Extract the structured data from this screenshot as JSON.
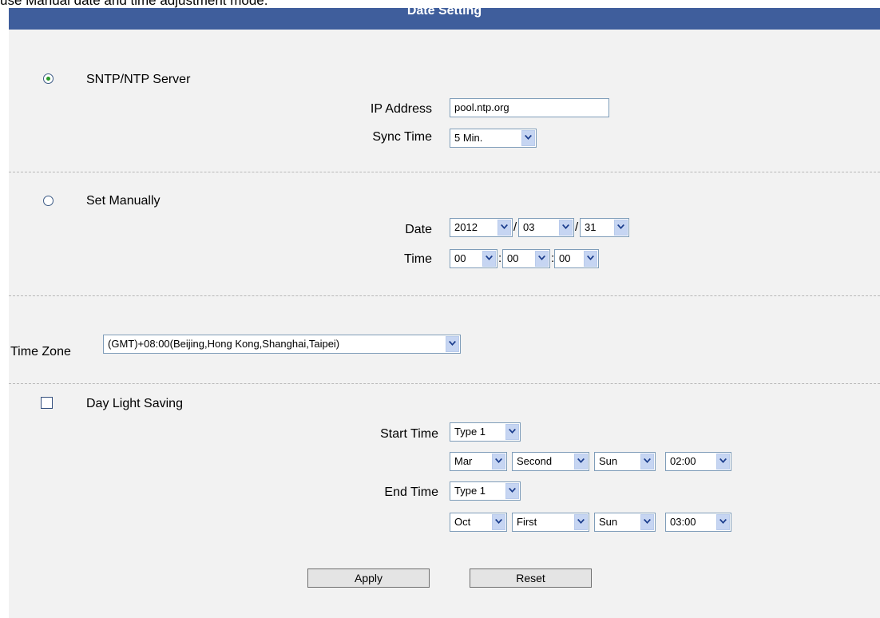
{
  "top_caption": "use Manual date and time adjustment mode.",
  "header": {
    "title": "Date Setting"
  },
  "sntp": {
    "label": "SNTP/NTP Server",
    "selected": true,
    "ip_label": "IP Address",
    "ip_value": "pool.ntp.org",
    "sync_label": "Sync Time",
    "sync_value": "5 Min."
  },
  "manual": {
    "label": "Set Manually",
    "selected": false,
    "date_label": "Date",
    "year": "2012",
    "month": "03",
    "day": "31",
    "time_label": "Time",
    "hour": "00",
    "minute": "00",
    "second": "00",
    "sep_slash": "/",
    "sep_colon": ":"
  },
  "timezone": {
    "label": "Time Zone",
    "value": "(GMT)+08:00(Beijing,Hong Kong,Shanghai,Taipei)"
  },
  "dst": {
    "label": "Day Light Saving",
    "checked": false,
    "start_label": "Start Time",
    "start_type": "Type 1",
    "start_month": "Mar",
    "start_week": "Second",
    "start_day": "Sun",
    "start_time": "02:00",
    "end_label": "End Time",
    "end_type": "Type 1",
    "end_month": "Oct",
    "end_week": "First",
    "end_day": "Sun",
    "end_time": "03:00"
  },
  "buttons": {
    "apply": "Apply",
    "reset": "Reset"
  },
  "colors": {
    "header_bar": "#3f5e9c",
    "panel_bg": "#f2f2f2",
    "radio_dot": "#2a9a2a",
    "dropdown_arrow_bg": "#c6d5f2"
  }
}
